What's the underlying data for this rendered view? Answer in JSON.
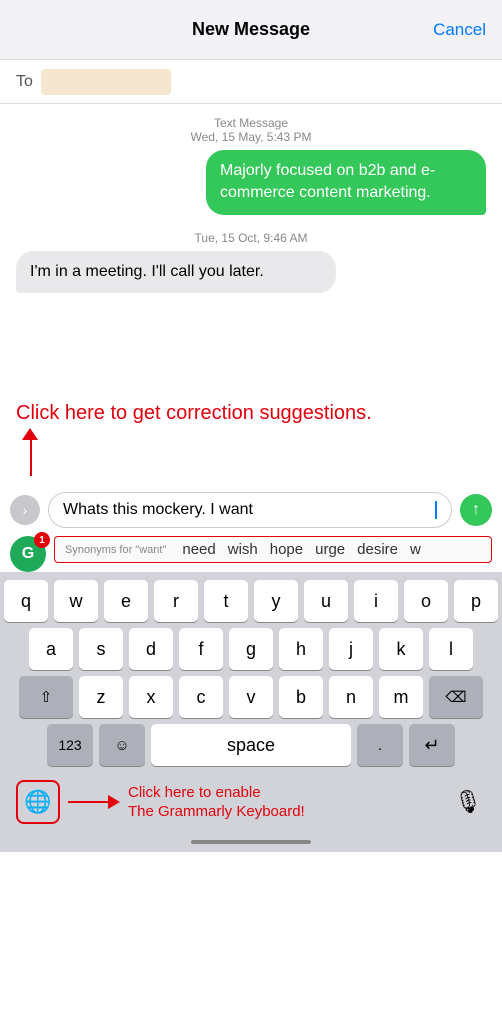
{
  "header": {
    "title": "New Message",
    "cancel_label": "Cancel"
  },
  "to_field": {
    "label": "To"
  },
  "messages": [
    {
      "meta": "Text Message\nWed, 15 May, 5:43 PM",
      "type": "sent",
      "text": "Majorly focused on b2b and e-commerce content marketing."
    },
    {
      "meta": "Tue, 15 Oct, 9:46 AM",
      "type": "received",
      "text": "I'm in a meeting. I'll call you later."
    }
  ],
  "annotation": {
    "click_correction": "Click here to get correction suggestions.",
    "bottom_text": "Click here to enable\nThe Grammarly Keyboard!"
  },
  "input": {
    "text": "Whats this mockery. I want",
    "send_icon": "↑"
  },
  "synonyms": {
    "label": "Synonyms for \"want\"",
    "words": [
      "need",
      "wish",
      "hope",
      "urge",
      "desire",
      "w"
    ]
  },
  "keyboard": {
    "rows": [
      [
        "q",
        "w",
        "e",
        "r",
        "t",
        "y",
        "u",
        "i",
        "o",
        "p"
      ],
      [
        "a",
        "s",
        "d",
        "f",
        "g",
        "h",
        "j",
        "k",
        "l"
      ],
      [
        "z",
        "x",
        "c",
        "v",
        "b",
        "n",
        "m"
      ]
    ],
    "bottom": {
      "numbers_label": "123",
      "space_label": "space",
      "period": "."
    }
  },
  "grammarly": {
    "letter": "G",
    "badge": "1"
  },
  "expand_icon": "›",
  "globe_icon": "🌐",
  "microphone_icon": "🎙",
  "emoji_icon": "☺",
  "shift_icon": "⇧",
  "delete_icon": "⌫",
  "return_icon": "↵"
}
